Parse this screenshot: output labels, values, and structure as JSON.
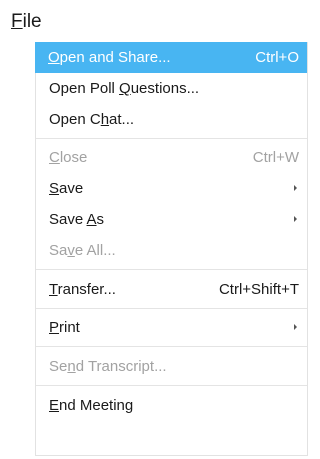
{
  "menubar": {
    "title_mnemonic": "F",
    "title_rest": "ile"
  },
  "menu": {
    "open_share": {
      "pre": "",
      "key": "O",
      "post": "pen and Share...",
      "shortcut": "Ctrl+O"
    },
    "open_poll": {
      "pre": "Open Poll ",
      "key": "Q",
      "post": "uestions..."
    },
    "open_chat": {
      "pre": "Open C",
      "key": "h",
      "post": "at..."
    },
    "close": {
      "pre": "",
      "key": "C",
      "post": "lose",
      "shortcut": "Ctrl+W"
    },
    "save": {
      "pre": "",
      "key": "S",
      "post": "ave"
    },
    "save_as": {
      "pre": "Save ",
      "key": "A",
      "post": "s"
    },
    "save_all": {
      "pre": "Sa",
      "key": "v",
      "post": "e All..."
    },
    "transfer": {
      "pre": "",
      "key": "T",
      "post": "ransfer...",
      "shortcut": "Ctrl+Shift+T"
    },
    "print": {
      "pre": "",
      "key": "P",
      "post": "rint"
    },
    "send_transcript": {
      "pre": "Se",
      "key": "n",
      "post": "d Transcript..."
    },
    "end_meeting": {
      "pre": "",
      "key": "E",
      "post": "nd Meeting"
    }
  },
  "colors": {
    "highlight": "#48b5f2",
    "disabled_text": "#a2a2a2",
    "separator": "#e4e4e4"
  }
}
